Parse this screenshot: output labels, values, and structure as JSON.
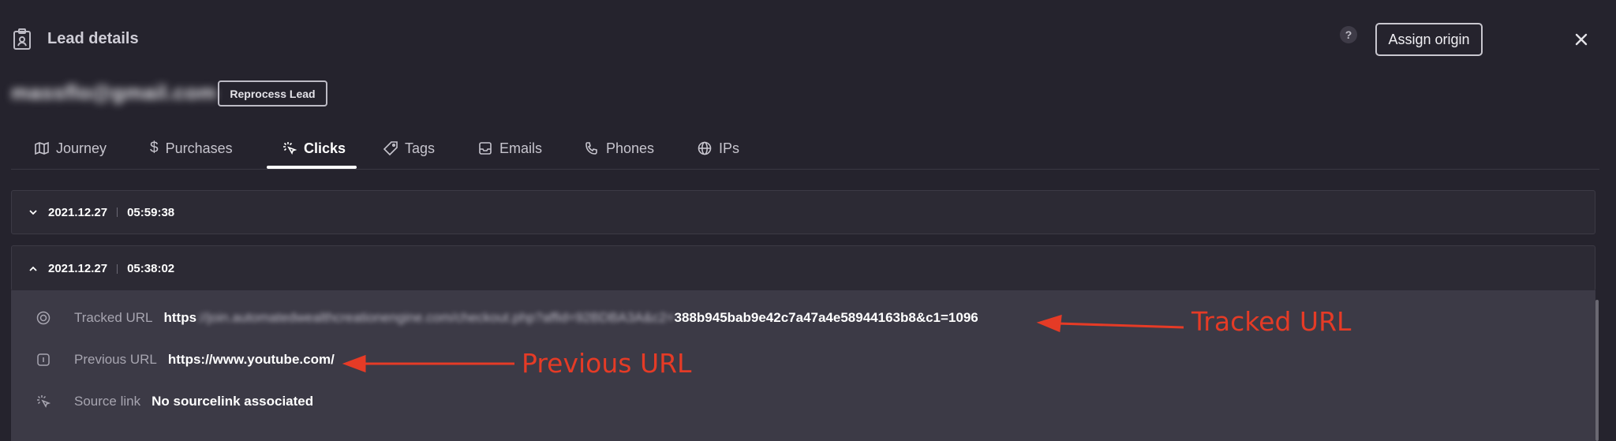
{
  "header": {
    "title": "Lead details",
    "help_label": "?",
    "assign_label": "Assign origin"
  },
  "lead": {
    "email": "massflo@gmail.com",
    "reprocess_label": "Reprocess Lead"
  },
  "tabs": [
    {
      "label": "Journey",
      "icon": "map-icon"
    },
    {
      "label": "Purchases",
      "icon": "dollar-icon"
    },
    {
      "label": "Clicks",
      "icon": "click-icon",
      "active": true
    },
    {
      "label": "Tags",
      "icon": "tag-icon"
    },
    {
      "label": "Emails",
      "icon": "inbox-icon"
    },
    {
      "label": "Phones",
      "icon": "phone-icon"
    },
    {
      "label": "IPs",
      "icon": "globe-icon"
    }
  ],
  "clicks": [
    {
      "date": "2021.12.27",
      "time": "05:59:38",
      "expanded": false
    },
    {
      "date": "2021.12.27",
      "time": "05:38:02",
      "expanded": true
    }
  ],
  "click_detail": {
    "tracked_url_label": "Tracked URL",
    "tracked_url_prefix": "https",
    "tracked_url_hidden": "://join.automatedwealthcreationengine.com/checkout.php?affid=92BDBA3A&c2=",
    "tracked_url_visible": "388b945bab9e42c7a47a4e58944163b8&c1=1096",
    "previous_url_label": "Previous URL",
    "previous_url_value": "https://www.youtube.com/",
    "source_link_label": "Source link",
    "source_link_value": "No sourcelink associated"
  },
  "annotations": {
    "tracked": "Tracked URL",
    "previous": "Previous URL",
    "color": "#e53b26"
  },
  "colors": {
    "background": "#25232d",
    "panel": "#3c3a46",
    "accent": "#ffffff"
  }
}
